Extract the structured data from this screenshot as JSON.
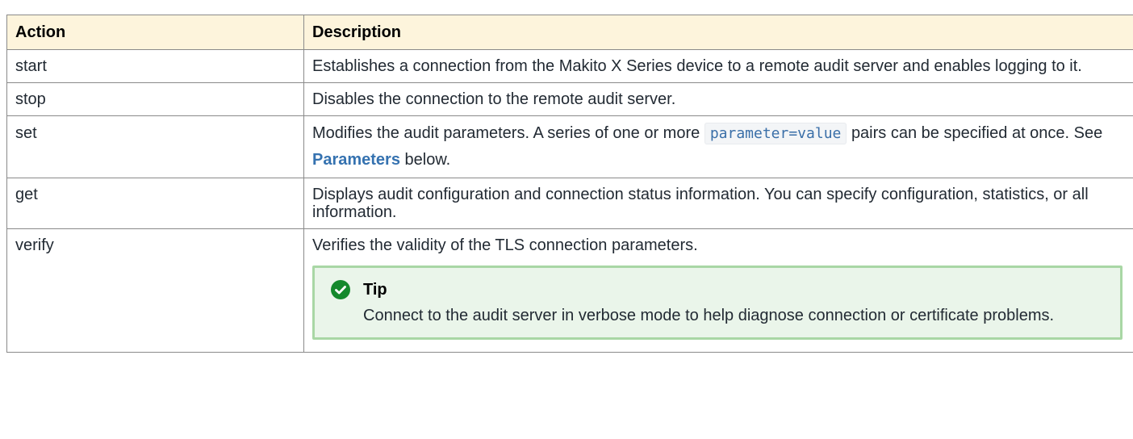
{
  "table": {
    "headers": {
      "action": "Action",
      "description": "Description"
    },
    "rows": {
      "start": {
        "action": "start",
        "description": "Establishes a connection from the Makito X Series device to a remote audit server and enables logging to it."
      },
      "stop": {
        "action": "stop",
        "description": "Disables the connection to the remote audit server."
      },
      "set": {
        "action": "set",
        "description_before": "Modifies the audit parameters. A series of one or more",
        "code": "parameter=value",
        "description_middle": "pairs can be specified at once. See",
        "link": "Parameters",
        "description_after": "below."
      },
      "get": {
        "action": "get",
        "description": "Displays audit configuration and connection status information. You can specify configuration, statistics, or all information."
      },
      "verify": {
        "action": "verify",
        "description": "Verifies the validity of the TLS connection parameters.",
        "tip": {
          "icon": "check-circle-icon",
          "title": "Tip",
          "body": "Connect to the audit server in verbose mode to help diagnose connection or certificate problems."
        }
      }
    }
  },
  "colors": {
    "header_bg": "#fdf4dc",
    "border": "#8a8a8a",
    "link": "#3572b0",
    "code": "#3a6fa8",
    "tip_bg": "#eaf5ea",
    "tip_border": "#a9d7a5",
    "tip_icon": "#14892c"
  }
}
